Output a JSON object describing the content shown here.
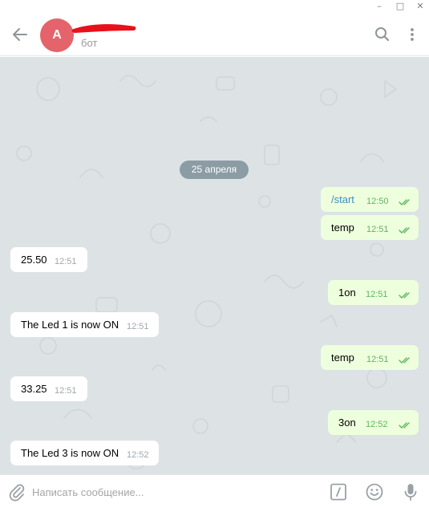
{
  "window": {
    "minimize_glyph": "–",
    "maximize_glyph": "□",
    "close_glyph": "✕"
  },
  "header": {
    "avatar_letter": "A",
    "chat_name": "",
    "status": "бот",
    "back_icon": "arrow-left-icon",
    "search_icon": "search-icon",
    "menu_icon": "vertical-dots-icon",
    "avatar_color": "#e5636a"
  },
  "chat": {
    "background_color": "#dde2e5",
    "date_label": "25 апреля",
    "messages": [
      {
        "direction": "out",
        "text": "/start",
        "time": "12:50",
        "read": true
      },
      {
        "direction": "out",
        "text": "temp",
        "time": "12:51",
        "read": true
      },
      {
        "direction": "in",
        "text": "25.50",
        "time": "12:51"
      },
      {
        "direction": "out",
        "text": "1on",
        "time": "12:51",
        "read": true
      },
      {
        "direction": "in",
        "text": "The Led 1 is now ON",
        "time": "12:51"
      },
      {
        "direction": "out",
        "text": "temp",
        "time": "12:51",
        "read": true
      },
      {
        "direction": "in",
        "text": "33.25",
        "time": "12:51"
      },
      {
        "direction": "out",
        "text": "3on",
        "time": "12:52",
        "read": true
      },
      {
        "direction": "in",
        "text": "The Led 3 is now ON",
        "time": "12:52"
      }
    ]
  },
  "composer": {
    "placeholder": "Написать сообщение...",
    "attach_icon": "paperclip-icon",
    "commands_icon": "slash-commands-icon",
    "emoji_icon": "smiley-icon",
    "mic_icon": "microphone-icon"
  },
  "colors": {
    "outgoing_bubble": "#eeffde",
    "incoming_bubble": "#ffffff",
    "read_ticks": "#5eb65f",
    "command_link": "#3c8ec7",
    "date_pill": "#8b9ca4"
  }
}
